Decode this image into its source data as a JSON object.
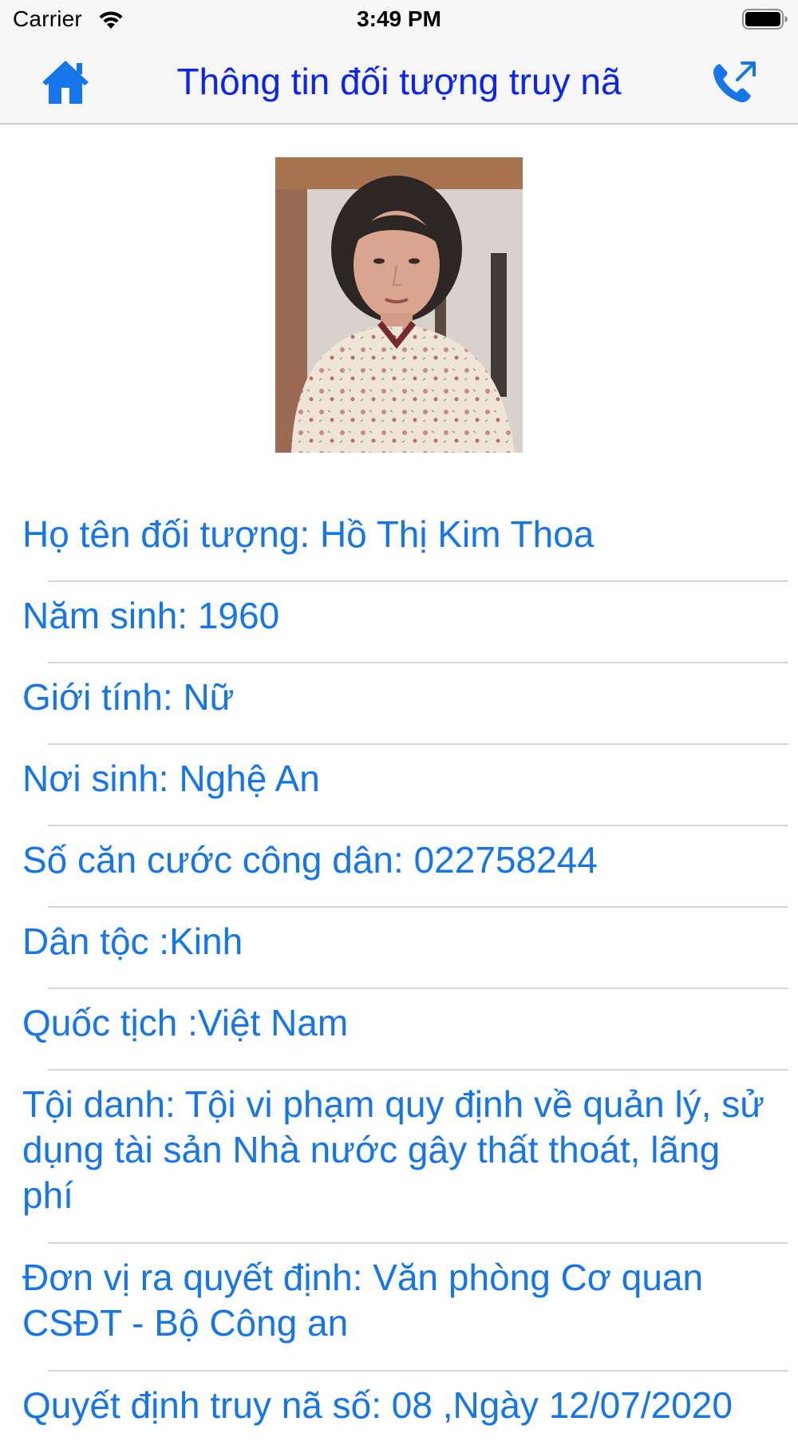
{
  "status_bar": {
    "carrier": "Carrier",
    "time": "3:49 PM",
    "wifi_icon": "wifi-icon",
    "battery_icon": "battery-full-icon"
  },
  "nav_bar": {
    "title": "Thông tin đối tượng truy nã",
    "home_icon": "home-icon",
    "call_icon": "outgoing-call-icon",
    "accent_color": "#0a25f2"
  },
  "photo": {
    "content": "portrait-photo"
  },
  "info": {
    "color": "#1476ea",
    "items": [
      {
        "label": "Họ tên đối tượng: Hồ Thị Kim Thoa"
      },
      {
        "label": "Năm sinh: 1960"
      },
      {
        "label": "Giới tính: Nữ"
      },
      {
        "label": "Nơi sinh: Nghệ An"
      },
      {
        "label": "Số căn cước công dân: 022758244"
      },
      {
        "label": "Dân tộc :Kinh"
      },
      {
        "label": "Quốc tịch :Việt Nam"
      },
      {
        "label": "Tội danh: Tội vi phạm quy định về quản lý, sử dụng tài sản Nhà nước gây thất thoát, lãng phí"
      },
      {
        "label": "Đơn vị ra quyết định: Văn phòng Cơ quan CSĐT - Bộ Công an"
      },
      {
        "label": "Quyết định truy nã số: 08 ,Ngày 12/07/2020"
      }
    ]
  }
}
